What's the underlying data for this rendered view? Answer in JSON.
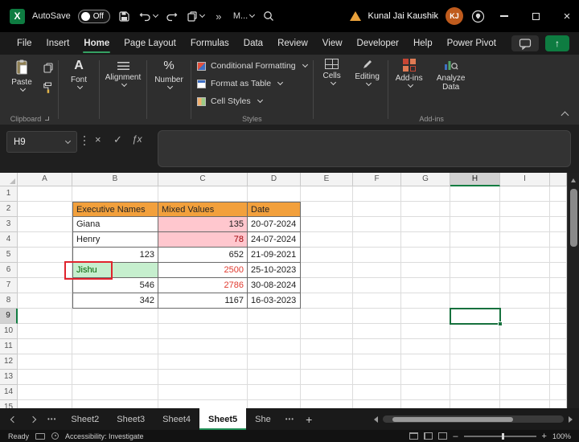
{
  "titlebar": {
    "autosave_label": "AutoSave",
    "autosave_state": "Off",
    "quick_access_more": "M...",
    "user_name": "Kunal Jai Kaushik",
    "user_initials": "KJ"
  },
  "icons": {
    "excel_logo": "X",
    "overflow": "»",
    "minimize_hint": "minimize",
    "close": "×",
    "cancel": "×",
    "check": "✓",
    "fx": "ƒx",
    "share_arrow": "↑",
    "font_a": "A",
    "percent": "%",
    "new_sheet": "+",
    "tab_dots": "•••"
  },
  "menu": {
    "items": [
      "File",
      "Insert",
      "Home",
      "Page Layout",
      "Formulas",
      "Data",
      "Review",
      "View",
      "Developer",
      "Help",
      "Power Pivot"
    ],
    "active": "Home"
  },
  "ribbon": {
    "paste": "Paste",
    "clipboard_group": "Clipboard",
    "font": "Font",
    "alignment": "Alignment",
    "number": "Number",
    "conditional_formatting": "Conditional Formatting",
    "format_as_table": "Format as Table",
    "cell_styles": "Cell Styles",
    "styles_group": "Styles",
    "cells": "Cells",
    "editing": "Editing",
    "addins": "Add-ins",
    "addins_group": "Add-ins",
    "analyze_data": "Analyze Data"
  },
  "formula_bar": {
    "name_box": "H9",
    "formula_value": ""
  },
  "grid": {
    "columns": [
      "A",
      "B",
      "C",
      "D",
      "E",
      "F",
      "G",
      "H",
      "I"
    ],
    "row_count": 15,
    "selected_column": "H",
    "selected_row": 9,
    "selection_cell": "H9",
    "cells": [
      {
        "ref": "B2",
        "text": "Executive Names",
        "style": "hdr"
      },
      {
        "ref": "C2",
        "text": "Mixed Values",
        "style": "hdr"
      },
      {
        "ref": "D2",
        "text": "Date",
        "style": "hdr"
      },
      {
        "ref": "B3",
        "text": "Giana",
        "style": ""
      },
      {
        "ref": "C3",
        "text": "135",
        "style": "num pink"
      },
      {
        "ref": "D3",
        "text": "20-07-2024",
        "style": ""
      },
      {
        "ref": "B4",
        "text": "Henry",
        "style": ""
      },
      {
        "ref": "C4",
        "text": "78",
        "style": "num pink dred"
      },
      {
        "ref": "D4",
        "text": "24-07-2024",
        "style": ""
      },
      {
        "ref": "B5",
        "text": "123",
        "style": "num"
      },
      {
        "ref": "C5",
        "text": "652",
        "style": "num"
      },
      {
        "ref": "D5",
        "text": "21-09-2021",
        "style": ""
      },
      {
        "ref": "B6",
        "text": "Jishu",
        "style": "gfill"
      },
      {
        "ref": "C6",
        "text": "2500",
        "style": "num red"
      },
      {
        "ref": "D6",
        "text": "25-10-2023",
        "style": ""
      },
      {
        "ref": "B7",
        "text": "546",
        "style": "num"
      },
      {
        "ref": "C7",
        "text": "2786",
        "style": "num red"
      },
      {
        "ref": "D7",
        "text": "30-08-2024",
        "style": ""
      },
      {
        "ref": "B8",
        "text": "342",
        "style": "num"
      },
      {
        "ref": "C8",
        "text": "1167",
        "style": "num"
      },
      {
        "ref": "D8",
        "text": "16-03-2023",
        "style": ""
      }
    ]
  },
  "sheet_tabs": {
    "tabs": [
      "Sheet2",
      "Sheet3",
      "Sheet4",
      "Sheet5",
      "She"
    ],
    "active": "Sheet5"
  },
  "status_bar": {
    "mode": "Ready",
    "accessibility": "Accessibility: Investigate",
    "zoom": "100%"
  },
  "colors": {
    "accent_green": "#107C41",
    "table_header_fill": "#F2A03C",
    "bad_fill": "#FFC7CE",
    "bad_text": "#9C0006",
    "good_fill": "#C6EFCE",
    "good_text": "#006100",
    "red_number_text": "#E03A2F",
    "annotation_red": "#E0242E",
    "avatar_orange": "#BF5B1D"
  }
}
